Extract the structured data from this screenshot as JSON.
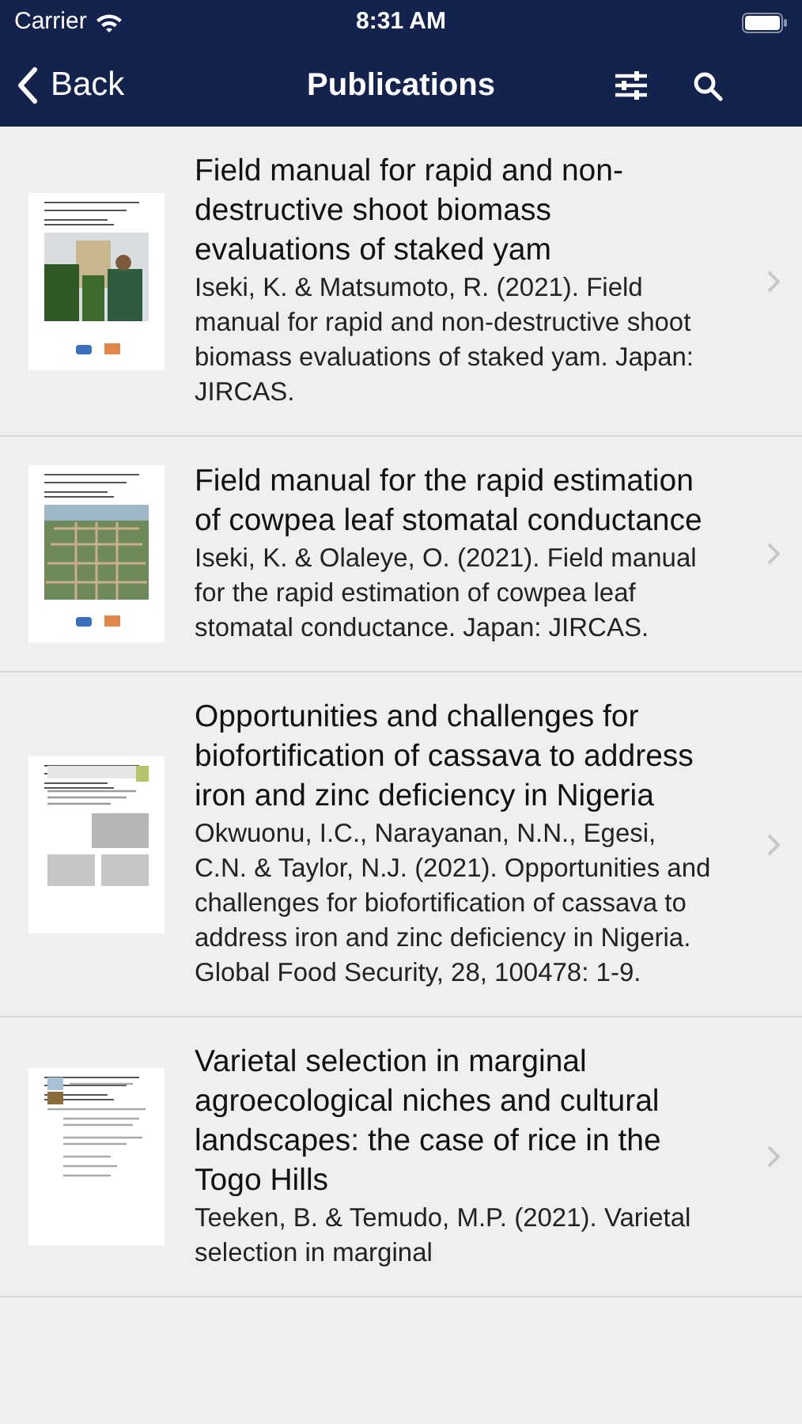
{
  "status_bar": {
    "carrier": "Carrier",
    "time": "8:31 AM"
  },
  "nav_bar": {
    "back": "Back",
    "title": "Publications"
  },
  "publications": [
    {
      "title": "Field manual for rapid and non-destructive shoot biomass evaluations of staked yam",
      "citation": "Iseki, K. & Matsumoto, R. (2021). Field manual for rapid and non-destructive shoot biomass evaluations of staked yam. Japan: JIRCAS."
    },
    {
      "title": "Field manual for the rapid estimation of cowpea leaf stomatal conductance",
      "citation": "Iseki, K. & Olaleye, O. (2021). Field manual for the rapid estimation of cowpea leaf stomatal conductance. Japan: JIRCAS."
    },
    {
      "title": "Opportunities and challenges for biofortification of cassava to address iron and zinc deficiency in Nigeria",
      "citation": "Okwuonu, I.C., Narayanan, N.N., Egesi, C.N. & Taylor, N.J. (2021). Opportunities and challenges for biofortification of cassava to address iron and zinc deficiency in Nigeria. Global Food Security, 28, 100478: 1-9."
    },
    {
      "title": "Varietal selection in marginal agroecological niches and cultural landscapes: the case of rice in the Togo Hills",
      "citation": "Teeken, B. & Temudo, M.P. (2021). Varietal selection in marginal"
    }
  ]
}
